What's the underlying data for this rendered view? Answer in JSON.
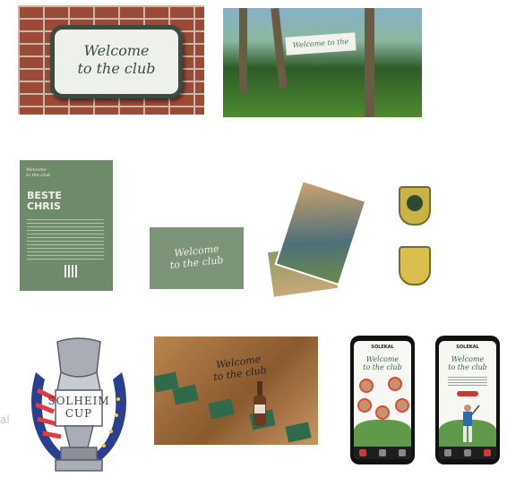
{
  "brick_sign": {
    "line1": "Welcome",
    "line2": "to the club"
  },
  "banner": {
    "text": "Welcome to the club"
  },
  "letter": {
    "small1": "Welcome",
    "small2": "to the club",
    "name1": "BESTE",
    "name2": "CHRIS"
  },
  "card": {
    "line1": "Welcome",
    "line2": "to the club"
  },
  "table": {
    "line1": "Welcome",
    "line2": "to the club"
  },
  "solheim": {
    "line1": "SOLHEIM",
    "line2": "CUP",
    "ghost": "al"
  },
  "phone1": {
    "brand": "SOLEKAL",
    "text1": "Welcome",
    "text2": "to the club"
  },
  "phone2": {
    "brand": "SOLEKAL",
    "text1": "Welcome",
    "text2": "to the club"
  },
  "colors": {
    "green": "#6f8a6a",
    "brick": "#9a4a36",
    "gold": "#d9c04d",
    "navy": "#1f3a8a",
    "red": "#c93a3a"
  }
}
